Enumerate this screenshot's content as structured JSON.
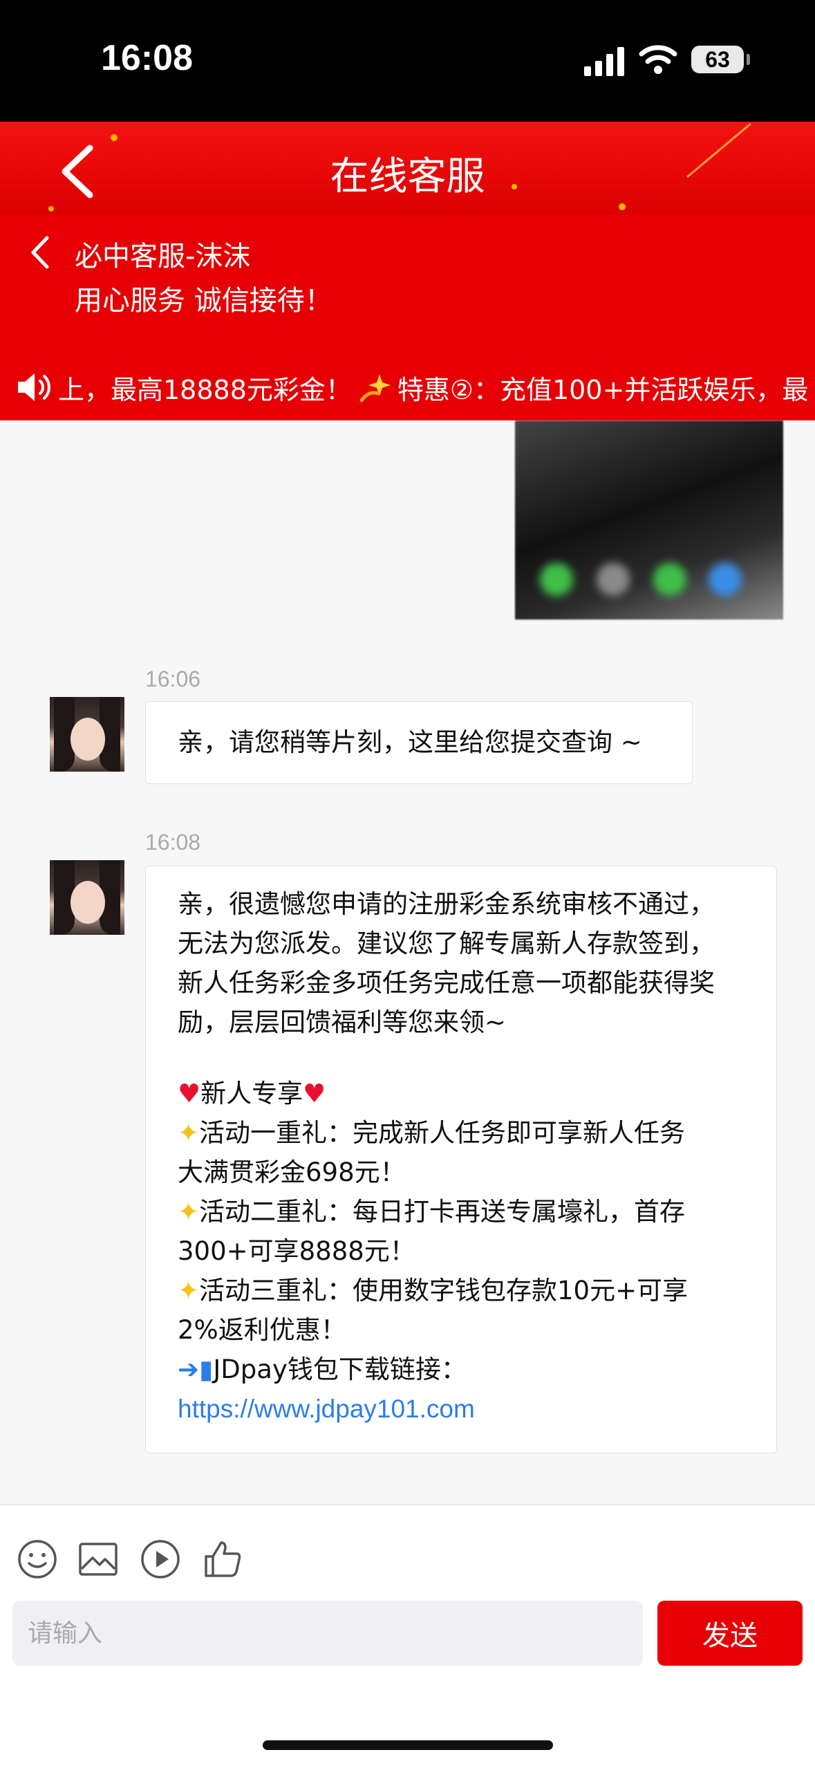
{
  "status_bar": {
    "time": "16:08",
    "battery": "63"
  },
  "header": {
    "title": "在线客服"
  },
  "agent": {
    "name": "必中客服-沫沫",
    "slogan": "用心服务 诚信接待！"
  },
  "marquee": {
    "text_1": "上，最高18888元彩金！",
    "text_2": "特惠②：充值100+并活跃娱乐，最"
  },
  "messages": [
    {
      "time": "16:06",
      "text": "亲，请您稍等片刻，这里给您提交查询 ~"
    },
    {
      "time": "16:08",
      "lines": [
        "亲，很遗憾您申请的注册彩金系统审核不通过，",
        "无法为您派发。建议您了解专属新人存款签到，",
        "新人任务彩金多项任务完成任意一项都能获得奖",
        "励，层层回馈福利等您来领~",
        "",
        "新人专享",
        "活动一重礼：完成新人任务即可享新人任务",
        "大满贯彩金698元！",
        "活动二重礼：每日打卡再送专属壕礼，首存",
        "300+可享8888元！",
        "活动三重礼：使用数字钱包存款10元+可享",
        "2%返利优惠！",
        "JDpay钱包下载链接："
      ],
      "link": "https://www.jdpay101.com"
    }
  ],
  "composer": {
    "placeholder": "请输入",
    "send_label": "发送"
  },
  "colors": {
    "brand_red": "#e60005",
    "link_blue": "#2b7de9"
  }
}
